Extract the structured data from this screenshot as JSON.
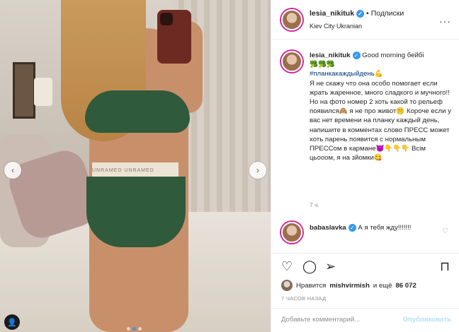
{
  "photo": {
    "band_text": "UNRAMED UNRAMED UNRAMED",
    "prev_label": "‹",
    "next_label": "›",
    "carousel_dots": 3,
    "active_dot": 1
  },
  "header": {
    "username": "lesia_nikituk",
    "verified_glyph": "✓",
    "separator": "•",
    "follow_label": "Подписки",
    "location": "Kiev City Ukranian",
    "more_glyph": "···"
  },
  "caption": {
    "username": "lesia_nikituk",
    "verified_glyph": "✓",
    "lead": "Good morning бейбі",
    "emoji_line": "🥦🥦🥦",
    "hashtag": "#планкакаждыйдень",
    "hashtag_emoji": "💪",
    "text1": "Я не скажу что она особо помогает если жрать жаренное, много сладкого и мучного!! Но на фото номер 2 хоть какой то рельеф появился",
    "emoji1": "🙈",
    "text2": " я не про живот",
    "emoji2": "🤫",
    "text3": " Короче если у вас нет времени на планку каждый день, напишите в комментах слово ПРЕСС может хоть парень появится с нормальным ПРЕССом в кармане",
    "emoji3": "😈👇👇👇",
    "text4": " Всім цьооом, я на зйомки",
    "emoji4": "😋",
    "time": "7 ч."
  },
  "comment": {
    "username": "babaslavka",
    "verified_glyph": "✓",
    "text": "А я тебя жду!!!!!!!",
    "heart_glyph": "♡"
  },
  "actions": {
    "like_glyph": "♡",
    "comment_glyph": "◯",
    "share_glyph": "➢",
    "save_glyph": "⊓"
  },
  "likes": {
    "prefix": "Нравится",
    "user": "mishvirmish",
    "middle": "и ещё",
    "count": "86 072"
  },
  "post_time": "7 ЧАСОВ НАЗАД",
  "add_comment": {
    "placeholder": "Добавьте комментарий...",
    "publish_label": "Опубликовать"
  },
  "colors": {
    "verified": "#3897f0",
    "publish_disabled": "#b2dffc",
    "hashtag": "#00376b",
    "border": "#efefef"
  }
}
